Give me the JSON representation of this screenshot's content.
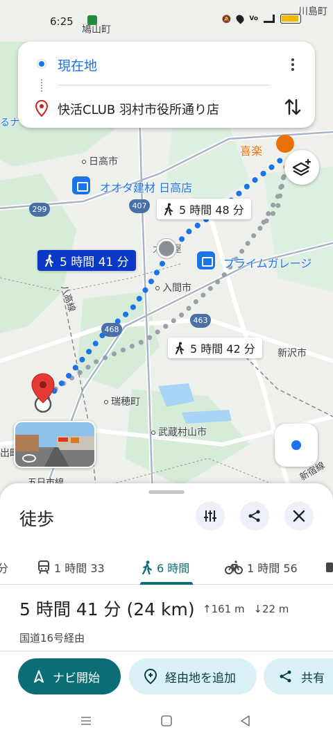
{
  "status": {
    "time": "6:25",
    "icons": [
      "notification-icon",
      "mute-icon",
      "location-icon",
      "volte-icon",
      "signal-icon",
      "battery-icon"
    ]
  },
  "route_card": {
    "origin": "現在地",
    "destination": "快活CLUB 羽村市役所通り店"
  },
  "map": {
    "labels": {
      "hatoyama": "鳩山町",
      "kawajima": "川島町",
      "hidaka": "日高市",
      "otaka_store": "オオタ建材 日高店",
      "prime": "プライムガレージ",
      "iruma": "入間市",
      "kirraku": "喜楽",
      "ohtaka": "大黒屋",
      "hachiko": "八高線",
      "mizuho": "瑞穂町",
      "musashimurayama": "武蔵村山市",
      "shinjuku": "新宿線",
      "niiza": "新沢市",
      "ome": "出町",
      "itsukaichi": "五日市線",
      "edge_left": "るナ"
    },
    "roads": [
      "407",
      "299",
      "468",
      "463"
    ],
    "bubbles": {
      "selected": "5 時間 41 分",
      "alt1": "5 時間 48 分",
      "alt2": "5 時間 42 分"
    }
  },
  "sheet": {
    "title": "徒歩",
    "tabs": [
      {
        "label": "分",
        "icon": "car-icon"
      },
      {
        "label": "1 時間 33",
        "icon": "train-icon"
      },
      {
        "label": "6 時間",
        "icon": "walk-icon"
      },
      {
        "label": "1 時間 56",
        "icon": "bike-icon"
      }
    ],
    "summary": "5 時間 41 分 (24 km)",
    "ascent": "161 m",
    "descent": "22 m",
    "via": "国道16号経由",
    "buttons": {
      "navigate": "ナビ開始",
      "add_stop": "経由地を追加",
      "share": "共有"
    }
  },
  "colors": {
    "route_blue": "#1a73e8",
    "accent_teal": "#0b6e76",
    "selected_bubble": "#0b38c4"
  }
}
